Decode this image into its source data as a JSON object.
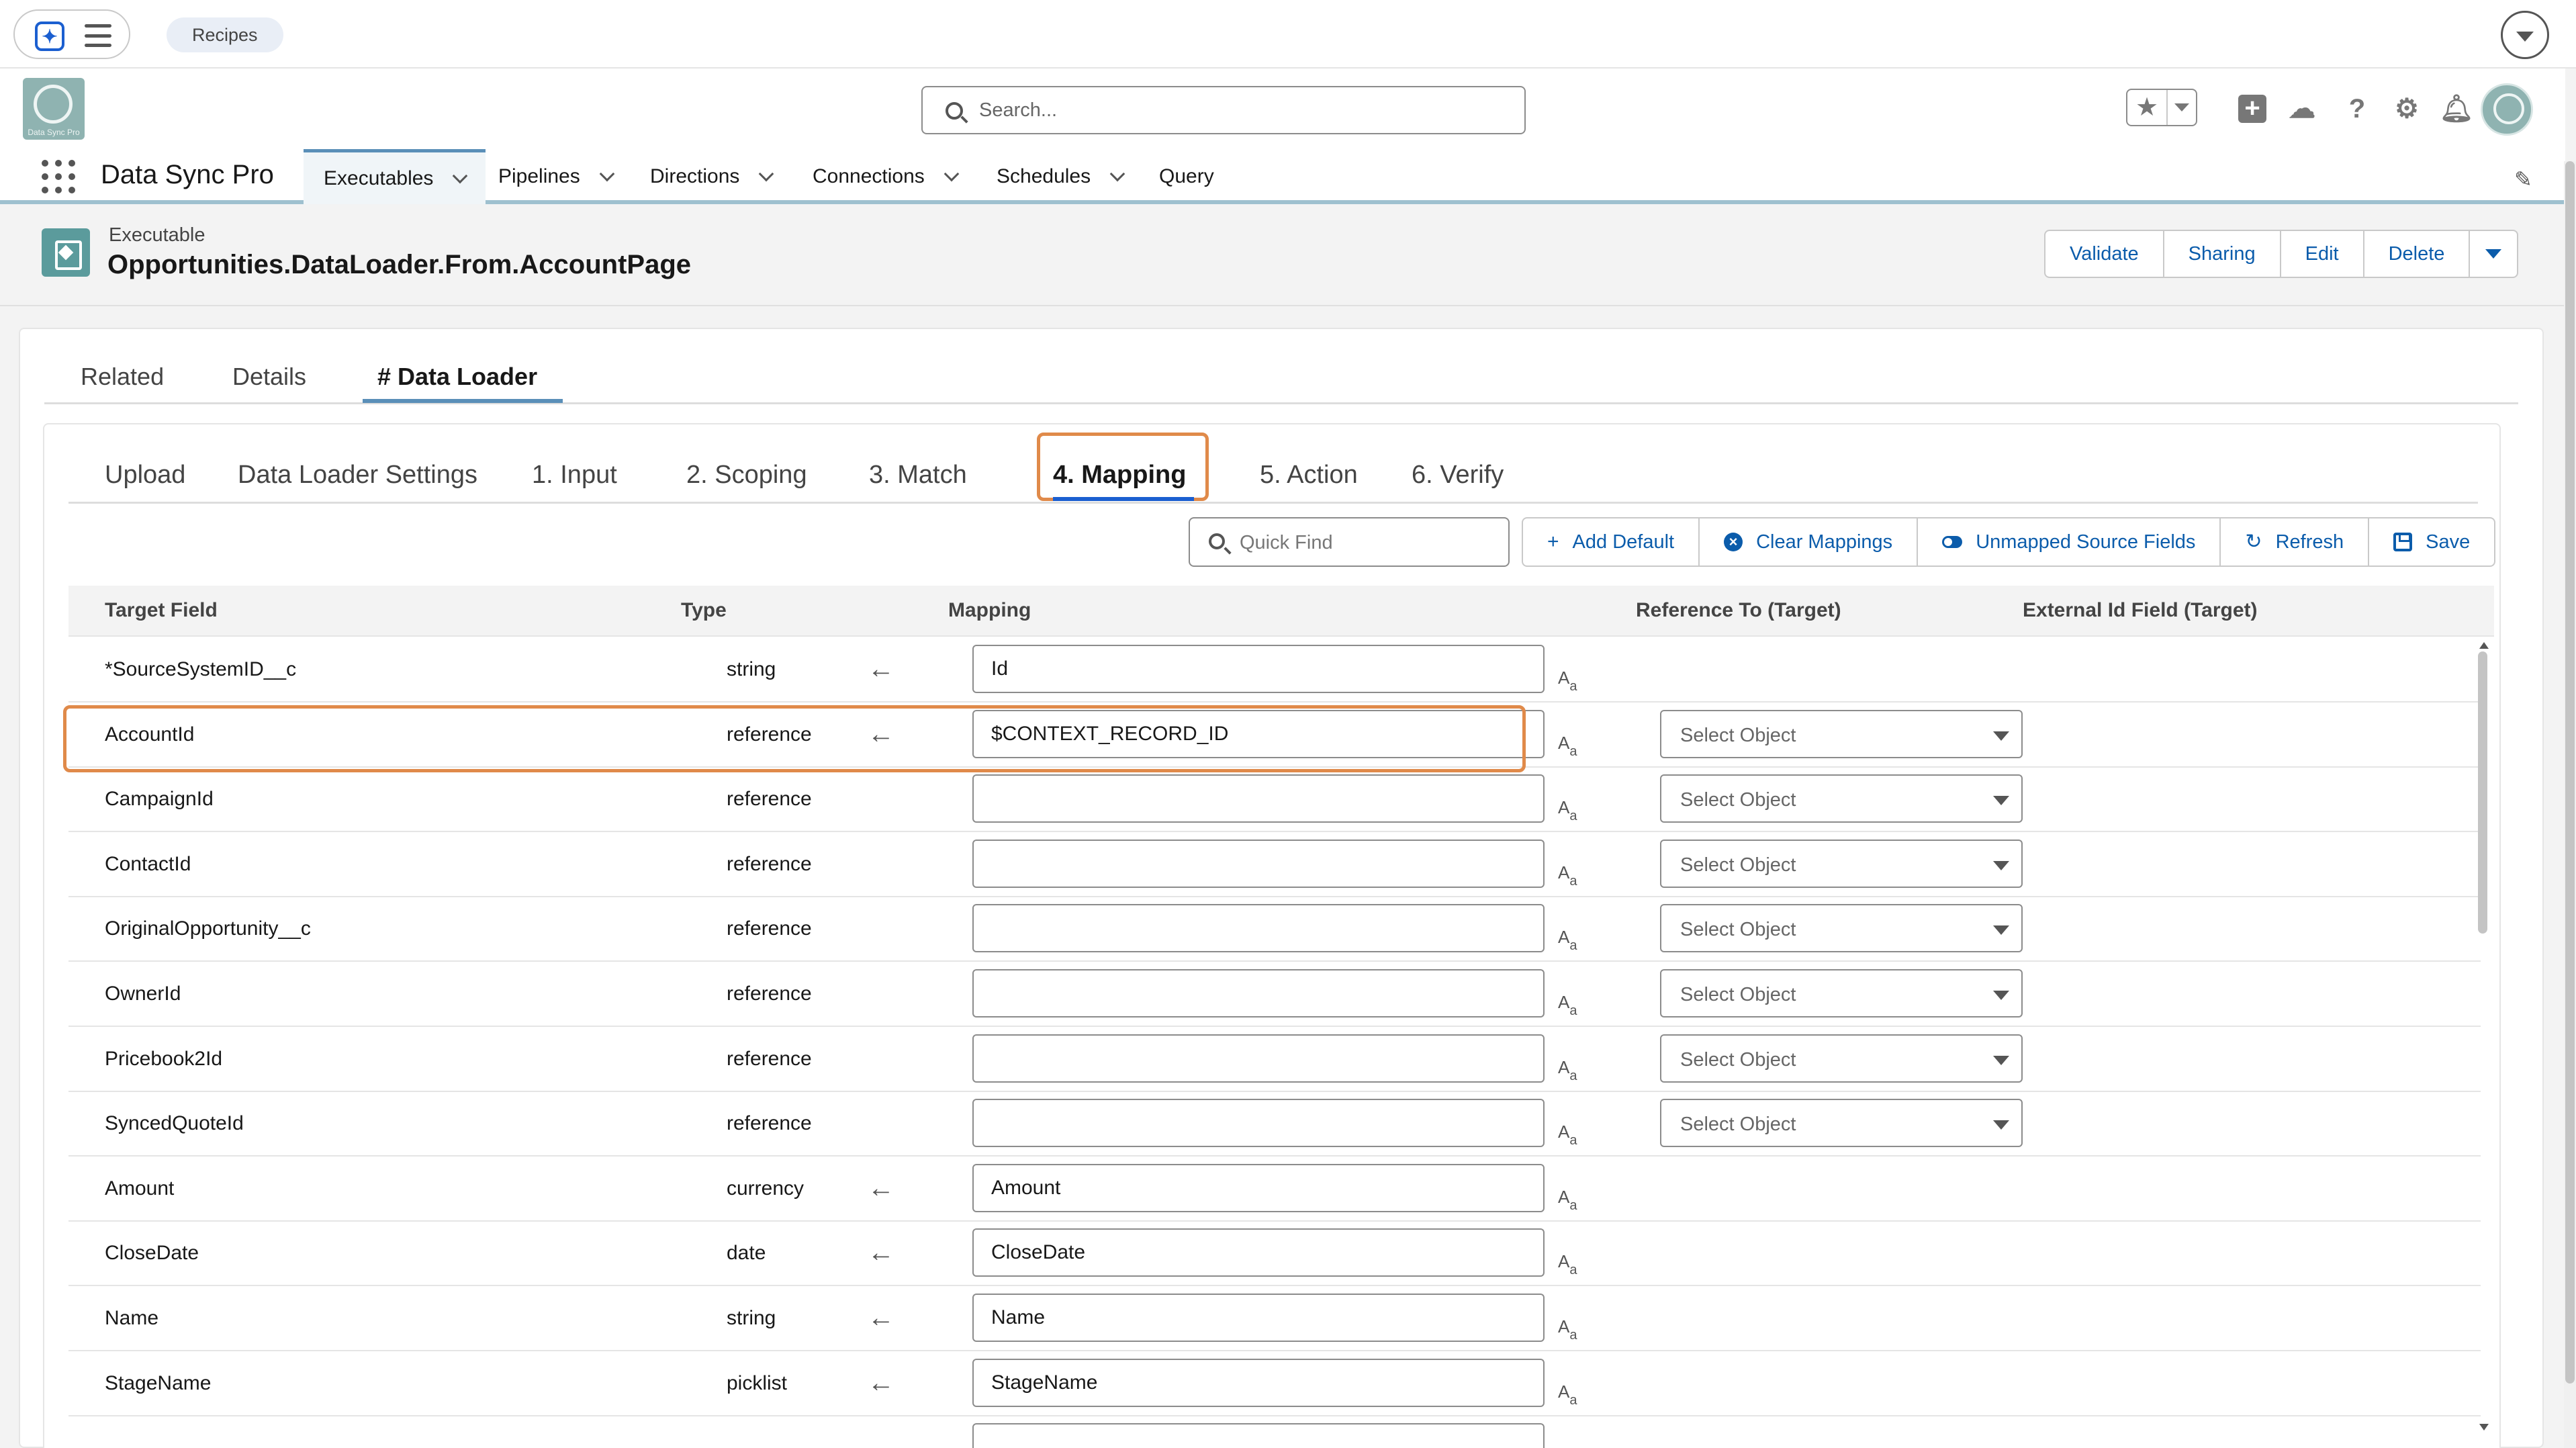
{
  "browser": {
    "assistant_chip": "Recipes"
  },
  "header": {
    "search_placeholder": "Search...",
    "logo_text": "Data Sync Pro"
  },
  "app_nav": {
    "app_name": "Data Sync Pro",
    "items": [
      {
        "label": "Executables",
        "has_menu": true,
        "active": true
      },
      {
        "label": "Pipelines",
        "has_menu": true
      },
      {
        "label": "Directions",
        "has_menu": true
      },
      {
        "label": "Connections",
        "has_menu": true
      },
      {
        "label": "Schedules",
        "has_menu": true
      },
      {
        "label": "Query",
        "has_menu": false
      }
    ]
  },
  "record": {
    "type": "Executable",
    "title": "Opportunities.DataLoader.From.AccountPage",
    "actions": [
      "Validate",
      "Sharing",
      "Edit",
      "Delete"
    ]
  },
  "record_tabs": [
    "Related",
    "Details",
    "# Data Loader"
  ],
  "record_tabs_active": "# Data Loader",
  "wizard_tabs": [
    "Upload",
    "Data Loader Settings",
    "1. Input",
    "2. Scoping",
    "3. Match",
    "4. Mapping",
    "5. Action",
    "6. Verify"
  ],
  "wizard_tabs_active": "4. Mapping",
  "toolbar": {
    "quick_find_placeholder": "Quick Find",
    "add_default": "Add Default",
    "clear_mappings": "Clear Mappings",
    "unmapped_source_fields": "Unmapped Source Fields",
    "refresh": "Refresh",
    "save": "Save"
  },
  "table": {
    "columns": [
      "Target Field",
      "Type",
      "Mapping",
      "Reference To (Target)",
      "External Id Field (Target)"
    ],
    "select_placeholder": "Select Object",
    "rows": [
      {
        "target": "*SourceSystemID__c",
        "type": "string",
        "mapped": true,
        "mapping": "Id",
        "reference": false
      },
      {
        "target": "AccountId",
        "type": "reference",
        "mapped": true,
        "mapping": "$CONTEXT_RECORD_ID",
        "reference": true,
        "highlighted": true
      },
      {
        "target": "CampaignId",
        "type": "reference",
        "mapped": false,
        "mapping": "",
        "reference": true
      },
      {
        "target": "ContactId",
        "type": "reference",
        "mapped": false,
        "mapping": "",
        "reference": true
      },
      {
        "target": "OriginalOpportunity__c",
        "type": "reference",
        "mapped": false,
        "mapping": "",
        "reference": true
      },
      {
        "target": "OwnerId",
        "type": "reference",
        "mapped": false,
        "mapping": "",
        "reference": true
      },
      {
        "target": "Pricebook2Id",
        "type": "reference",
        "mapped": false,
        "mapping": "",
        "reference": true
      },
      {
        "target": "SyncedQuoteId",
        "type": "reference",
        "mapped": false,
        "mapping": "",
        "reference": true
      },
      {
        "target": "Amount",
        "type": "currency",
        "mapped": true,
        "mapping": "Amount",
        "reference": false
      },
      {
        "target": "CloseDate",
        "type": "date",
        "mapped": true,
        "mapping": "CloseDate",
        "reference": false
      },
      {
        "target": "Name",
        "type": "string",
        "mapped": true,
        "mapping": "Name",
        "reference": false
      },
      {
        "target": "StageName",
        "type": "picklist",
        "mapped": true,
        "mapping": "StageName",
        "reference": false
      },
      {
        "target": "",
        "type": "",
        "mapped": false,
        "mapping": "",
        "reference": false,
        "partial": true
      }
    ]
  },
  "colors": {
    "brand_blue": "#0b5cab",
    "highlight_orange": "#e08a4a",
    "app_accent": "#5a8fb8",
    "logo_teal": "#8fb3b1"
  },
  "icons": {
    "assistant": "sparkle-icon",
    "menu": "hamburger-icon",
    "favorites": "star-icon",
    "add": "plus-square-icon",
    "trailhead": "cloud-icon",
    "help": "question-icon",
    "setup": "gear-icon",
    "notifications": "bell-icon",
    "edit_nav": "pencil-icon",
    "map_arrow": "arrow-left-icon",
    "text_format": "text-case-icon"
  }
}
